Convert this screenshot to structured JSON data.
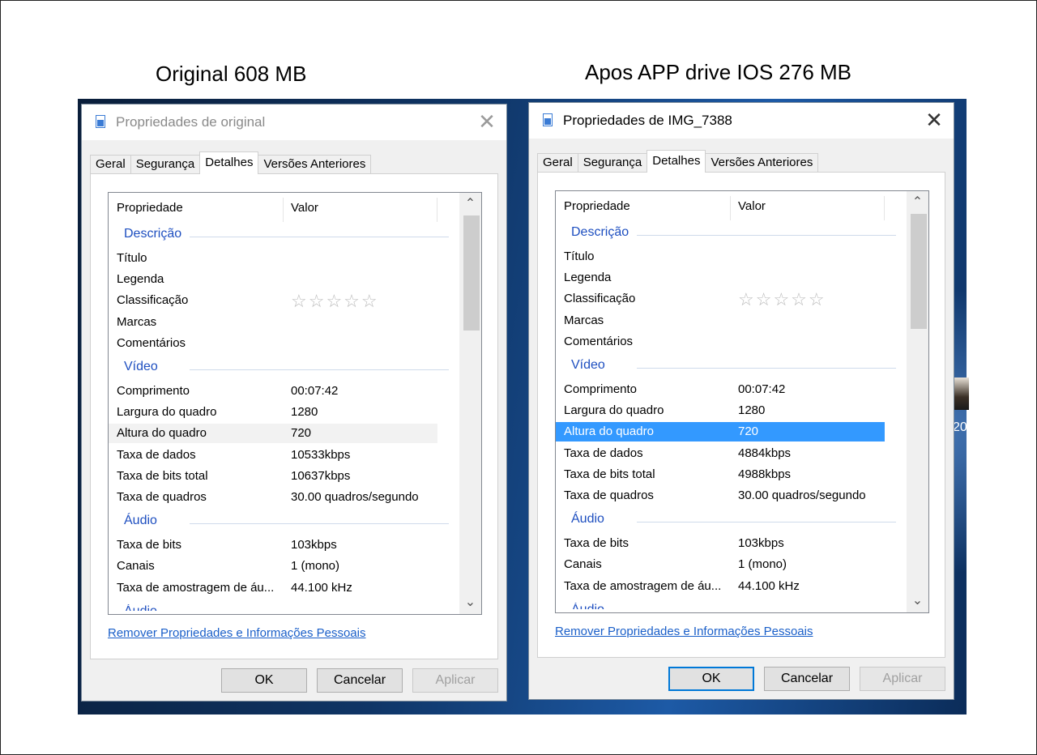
{
  "captions": {
    "left": "Original 608 MB",
    "right": "Apos APP drive IOS 276 MB"
  },
  "desktop": {
    "partial_thumbnail_text": "20"
  },
  "dialogs": [
    {
      "title": "Propriedades de original",
      "active": false,
      "tabs": [
        "Geral",
        "Segurança",
        "Detalhes",
        "Versões Anteriores"
      ],
      "active_tab": "Detalhes",
      "header": {
        "col_property": "Propriedade",
        "col_value": "Valor"
      },
      "groups": {
        "descricao": "Descrição",
        "video": "Vídeo",
        "audio": "Áudio",
        "next_partial": "Áudio"
      },
      "description_rows": [
        {
          "key": "Título",
          "value": ""
        },
        {
          "key": "Legenda",
          "value": ""
        },
        {
          "key": "Classificação",
          "value": "☆☆☆☆☆"
        },
        {
          "key": "Marcas",
          "value": ""
        },
        {
          "key": "Comentários",
          "value": ""
        }
      ],
      "video_rows": [
        {
          "key": "Comprimento",
          "value": "00:07:42"
        },
        {
          "key": "Largura do quadro",
          "value": "1280"
        },
        {
          "key": "Altura do quadro",
          "value": "720"
        },
        {
          "key": "Taxa de dados",
          "value": "10533kbps"
        },
        {
          "key": "Taxa de bits total",
          "value": "10637kbps"
        },
        {
          "key": "Taxa de quadros",
          "value": "30.00 quadros/segundo"
        }
      ],
      "audio_rows": [
        {
          "key": "Taxa de bits",
          "value": "103kbps"
        },
        {
          "key": "Canais",
          "value": "1 (mono)"
        },
        {
          "key": "Taxa de amostragem de áu...",
          "value": "44.100 kHz"
        }
      ],
      "highlight_row": "Altura do quadro",
      "highlight_style": "hover",
      "link": "Remover Propriedades e Informações Pessoais",
      "buttons": {
        "ok": "OK",
        "cancel": "Cancelar",
        "apply": "Aplicar"
      }
    },
    {
      "title": "Propriedades de IMG_7388",
      "active": true,
      "tabs": [
        "Geral",
        "Segurança",
        "Detalhes",
        "Versões Anteriores"
      ],
      "active_tab": "Detalhes",
      "header": {
        "col_property": "Propriedade",
        "col_value": "Valor"
      },
      "groups": {
        "descricao": "Descrição",
        "video": "Vídeo",
        "audio": "Áudio",
        "next_partial": "Áudio"
      },
      "description_rows": [
        {
          "key": "Título",
          "value": ""
        },
        {
          "key": "Legenda",
          "value": ""
        },
        {
          "key": "Classificação",
          "value": "☆☆☆☆☆"
        },
        {
          "key": "Marcas",
          "value": ""
        },
        {
          "key": "Comentários",
          "value": ""
        }
      ],
      "video_rows": [
        {
          "key": "Comprimento",
          "value": "00:07:42"
        },
        {
          "key": "Largura do quadro",
          "value": "1280"
        },
        {
          "key": "Altura do quadro",
          "value": "720"
        },
        {
          "key": "Taxa de dados",
          "value": "4884kbps"
        },
        {
          "key": "Taxa de bits total",
          "value": "4988kbps"
        },
        {
          "key": "Taxa de quadros",
          "value": "30.00 quadros/segundo"
        }
      ],
      "audio_rows": [
        {
          "key": "Taxa de bits",
          "value": "103kbps"
        },
        {
          "key": "Canais",
          "value": "1 (mono)"
        },
        {
          "key": "Taxa de amostragem de áu...",
          "value": "44.100 kHz"
        }
      ],
      "highlight_row": "Altura do quadro",
      "highlight_style": "selected",
      "link": "Remover Propriedades e Informações Pessoais",
      "buttons": {
        "ok": "OK",
        "cancel": "Cancelar",
        "apply": "Aplicar"
      }
    }
  ],
  "colors": {
    "group_heading": "#1e4fc0",
    "selection": "#3399ff",
    "link": "#1a5fc9"
  }
}
